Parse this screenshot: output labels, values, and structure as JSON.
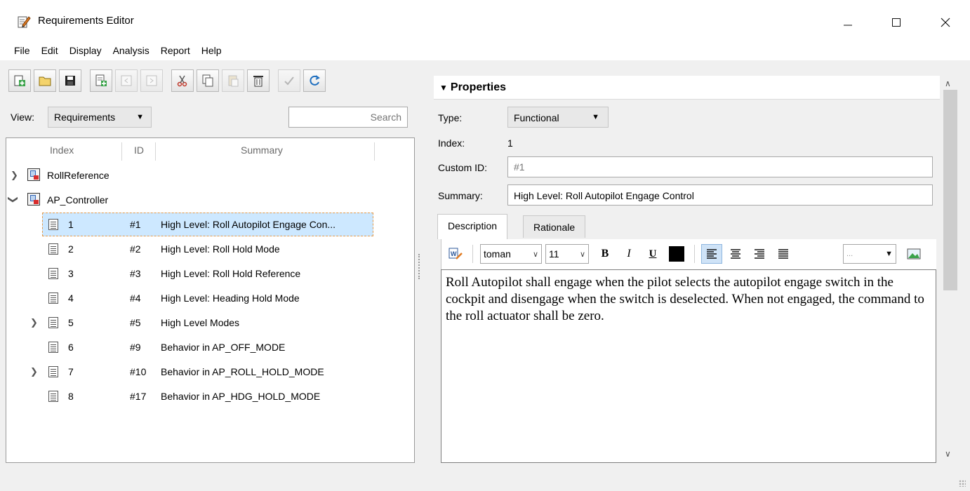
{
  "window": {
    "title": "Requirements Editor"
  },
  "menu": [
    "File",
    "Edit",
    "Display",
    "Analysis",
    "Report",
    "Help"
  ],
  "view": {
    "label": "View:",
    "selected": "Requirements"
  },
  "search": {
    "placeholder": "Search"
  },
  "tree": {
    "columns": [
      "Index",
      "ID",
      "Summary"
    ],
    "sets": [
      {
        "name": "RollReference",
        "expanded": false
      },
      {
        "name": "AP_Controller",
        "expanded": true
      }
    ],
    "rows": [
      {
        "index": "1",
        "id": "#1",
        "summary": "High Level: Roll Autopilot Engage Con...",
        "selected": true,
        "expandable": false
      },
      {
        "index": "2",
        "id": "#2",
        "summary": "High Level: Roll Hold Mode",
        "selected": false,
        "expandable": false
      },
      {
        "index": "3",
        "id": "#3",
        "summary": "High Level: Roll Hold Reference",
        "selected": false,
        "expandable": false
      },
      {
        "index": "4",
        "id": "#4",
        "summary": "High Level: Heading Hold Mode",
        "selected": false,
        "expandable": false
      },
      {
        "index": "5",
        "id": "#5",
        "summary": "High Level Modes",
        "selected": false,
        "expandable": true
      },
      {
        "index": "6",
        "id": "#9",
        "summary": "Behavior in AP_OFF_MODE",
        "selected": false,
        "expandable": false
      },
      {
        "index": "7",
        "id": "#10",
        "summary": "Behavior in AP_ROLL_HOLD_MODE",
        "selected": false,
        "expandable": true
      },
      {
        "index": "8",
        "id": "#17",
        "summary": "Behavior in AP_HDG_HOLD_MODE",
        "selected": false,
        "expandable": false
      }
    ]
  },
  "properties": {
    "header": "Properties",
    "type_label": "Type:",
    "type_value": "Functional",
    "index_label": "Index:",
    "index_value": "1",
    "custom_id_label": "Custom ID:",
    "custom_id_placeholder": "#1",
    "summary_label": "Summary:",
    "summary_value": "High Level: Roll Autopilot Engage Control"
  },
  "tabs": [
    "Description",
    "Rationale"
  ],
  "editor": {
    "font": "toman",
    "size": "11",
    "bold": "B",
    "italic": "I",
    "underline": "U",
    "style_value": "...",
    "text": "Roll Autopilot shall engage when the pilot selects the autopilot engage switch in the cockpit and disengage when the switch is deselected. When not engaged, the command to the roll actuator shall be zero."
  },
  "colors": {
    "selection": "#cde8ff",
    "selection_border": "#e49a4a",
    "font_color": "#000000"
  }
}
